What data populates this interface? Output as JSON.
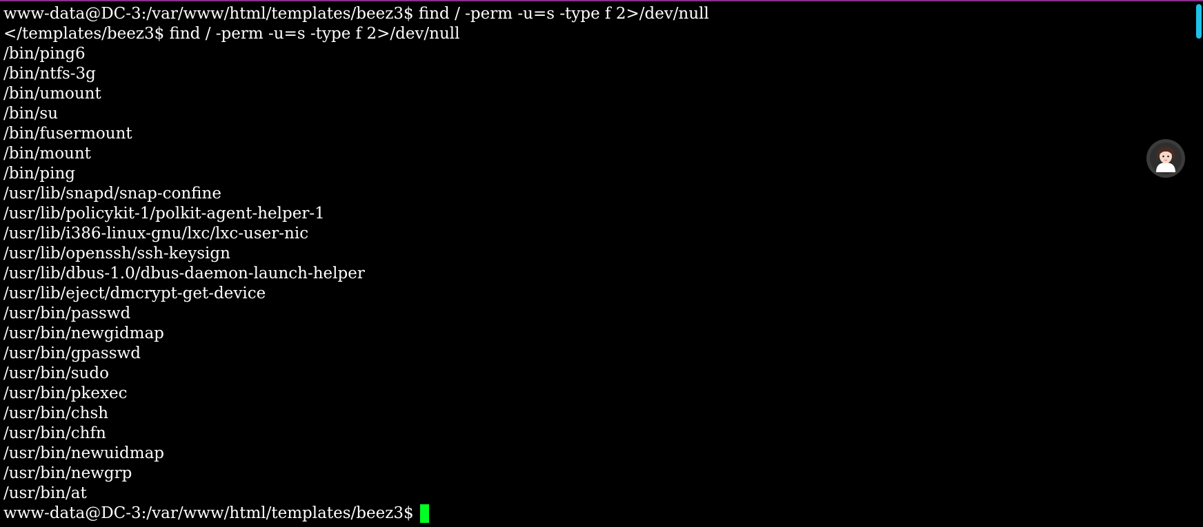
{
  "terminal": {
    "output_lines": [
      "www-data@DC-3:/var/www/html/templates/beez3$ find / -perm -u=s -type f 2>/dev/null",
      "</templates/beez3$ find / -perm -u=s -type f 2>/dev/null",
      "/bin/ping6",
      "/bin/ntfs-3g",
      "/bin/umount",
      "/bin/su",
      "/bin/fusermount",
      "/bin/mount",
      "/bin/ping",
      "/usr/lib/snapd/snap-confine",
      "/usr/lib/policykit-1/polkit-agent-helper-1",
      "/usr/lib/i386-linux-gnu/lxc/lxc-user-nic",
      "/usr/lib/openssh/ssh-keysign",
      "/usr/lib/dbus-1.0/dbus-daemon-launch-helper",
      "/usr/lib/eject/dmcrypt-get-device",
      "/usr/bin/passwd",
      "/usr/bin/newgidmap",
      "/usr/bin/gpasswd",
      "/usr/bin/sudo",
      "/usr/bin/pkexec",
      "/usr/bin/chsh",
      "/usr/bin/chfn",
      "/usr/bin/newuidmap",
      "/usr/bin/newgrp",
      "/usr/bin/at"
    ],
    "prompt": "www-data@DC-3:/var/www/html/templates/beez3$",
    "colors": {
      "background": "#000000",
      "text": "#ffffff",
      "cursor": "#00ff22",
      "scrollbar": "#1ec2e8",
      "window_border": "#8b2f8b"
    }
  },
  "assistant": {
    "icon": "assistant-avatar-icon"
  }
}
